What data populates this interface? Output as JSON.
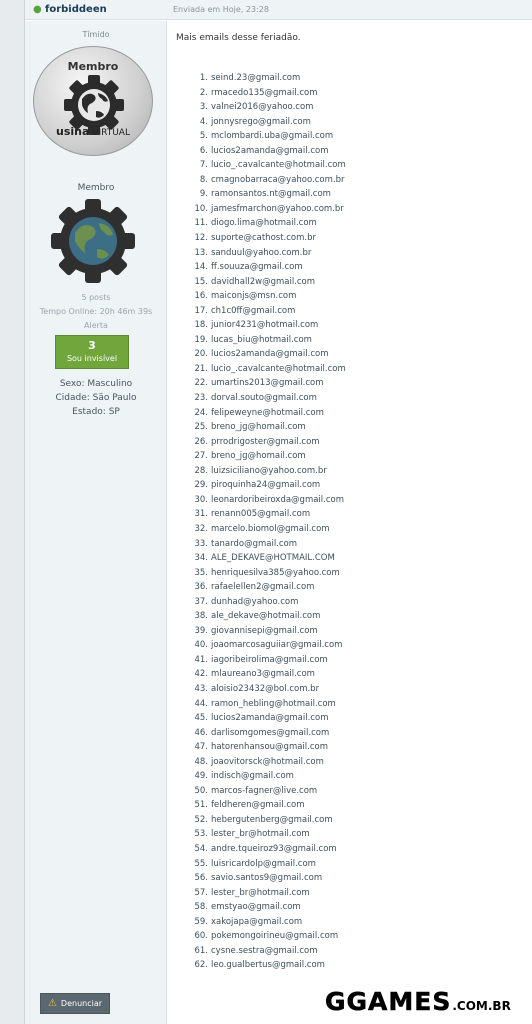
{
  "header": {
    "author": "forbiddeen",
    "date": "Enviada em Hoje, 23:28"
  },
  "sidebar": {
    "title_top": "Tímido",
    "badge_label": "Membro",
    "badge_footer_bold": "usina",
    "badge_footer_rest": " VIRTUAL",
    "rank_mid": "Membro",
    "posts": "5 posts",
    "online_time": "Tempo Online: 20h 46m 39s",
    "alert": "Alerta",
    "status_count": "3",
    "status_label": "Sou invisível",
    "sex": "Sexo: Masculino",
    "city": "Cidade: São Paulo",
    "state": "Estado: SP",
    "report_label": "Denunciar"
  },
  "post": {
    "intro": "Mais emails desse feriadão.",
    "emails": [
      "seind.23@gmail.com",
      "rmacedo135@gmail.com",
      "valnei2016@yahoo.com",
      "jonnysrego@gmail.com",
      "mclombardi.uba@gmail.com",
      "lucios2amanda@gmail.com",
      "lucio_.cavalcante@hotmail.com",
      "cmagnobarraca@yahoo.com.br",
      "ramonsantos.nt@gmail.com",
      "jamesfmarchon@yahoo.com.br",
      "diogo.lima@hotmail.com",
      "suporte@cathost.com.br",
      "sanduul@yahoo.com.br",
      "ff.souuza@gmail.com",
      "davidhall2w@gmail.com",
      "maiconjs@msn.com",
      "ch1c0ff@gmail.com",
      "junior4231@hotmail.com",
      "lucas_biu@hotmail.com",
      "lucios2amanda@gmail.com",
      "lucio_.cavalcante@hotmail.com",
      "umartins2013@gmail.com",
      "dorval.souto@gmail.com",
      "felipeweyne@hotmail.com",
      "breno_jg@homail.com",
      "prrodrigoster@gmail.com",
      "breno_jg@homail.com",
      "luizsiciliano@yahoo.com.br",
      "piroquinha24@gmail.com",
      "leonardoribeiroxda@gmail.com",
      "renann005@gmail.com",
      "marcelo.biomol@gmail.com",
      "tanardo@gmail.com",
      "ALE_DEKAVE@HOTMAIL.COM",
      "henriquesilva385@yahoo.com",
      "rafaelellen2@gmail.com",
      "dunhad@yahoo.com",
      "ale_dekave@hotmail.com",
      "giovannisepi@gmail.com",
      "joaomarcosaguiiar@gmail.com",
      "iagoribeirolima@gmail.com",
      "mlaureano3@gmail.com",
      "aloisio23432@bol.com.br",
      "ramon_hebling@hotmail.com",
      "lucios2amanda@gmail.com",
      "darlisomgomes@gmail.com",
      "hatorenhansou@gmail.com",
      "joaovitorsck@hotmail.com",
      "indisch@gmail.com",
      "marcos-fagner@live.com",
      "feldheren@gmail.com",
      "hebergutenberg@gmail.com",
      "lester_br@hotmail.com",
      "andre.tqueiroz93@gmail.com",
      "luisricardolp@gmail.com",
      "savio.santos9@gmail.com",
      "lester_br@hotmail.com",
      "emstyao@gmail.com",
      "xakojapa@gmail.com",
      "pokemongoirineu@gmail.com",
      "cysne.sestra@gmail.com",
      "leo.gualbertus@gmail.com"
    ]
  },
  "watermark": {
    "main": "GGAMES",
    "suffix": ".COM.BR"
  },
  "colors": {
    "online": "#5ba33b",
    "status_bg": "#71a63c",
    "report_bg": "#5c6870",
    "author": "#1b3d59"
  }
}
